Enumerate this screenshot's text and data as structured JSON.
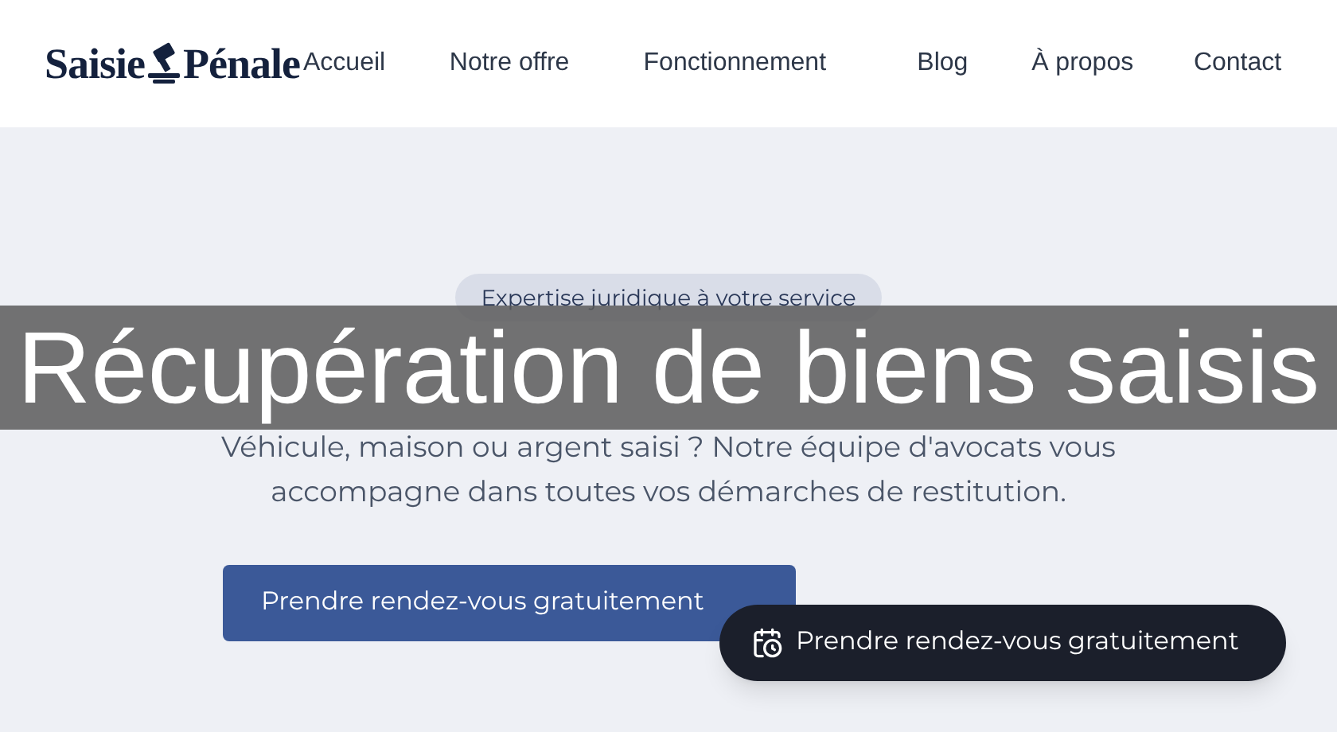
{
  "header": {
    "logo": {
      "left": "Saisie",
      "right": "Pénale"
    },
    "nav": [
      {
        "label": "Accueil"
      },
      {
        "label": "Notre offre"
      },
      {
        "label": "Fonctionnement"
      },
      {
        "label": "Blog"
      },
      {
        "label": "À propos"
      },
      {
        "label": "Contact"
      }
    ]
  },
  "hero": {
    "badge": "Expertise juridique à votre service",
    "subtitle": "Véhicule, maison ou argent saisi ? Notre équipe d'avocats vous accompagne dans toutes vos démarches de restitution.",
    "primary_button": "Prendre rendez-vous gratuitement"
  },
  "floating_button": "Prendre rendez-vous gratuitement",
  "overlay_banner": "Récupération de biens saisis"
}
